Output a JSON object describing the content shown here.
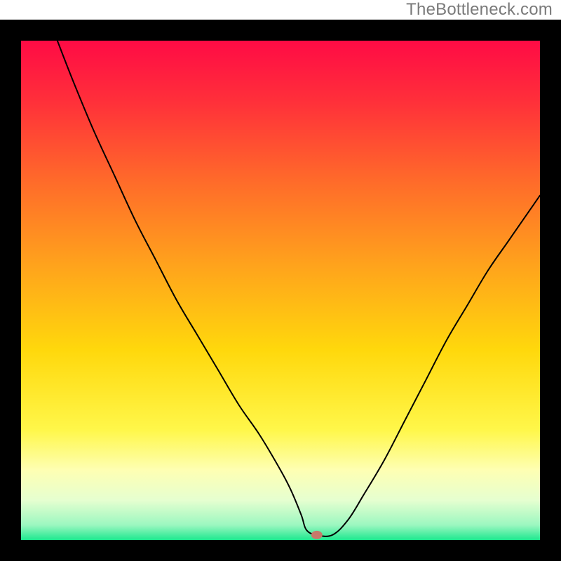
{
  "watermark": "TheBottleneck.com",
  "chart_data": {
    "type": "line",
    "title": "",
    "xlabel": "",
    "ylabel": "",
    "xlim": [
      0,
      100
    ],
    "ylim": [
      0,
      100
    ],
    "grid": false,
    "legend": false,
    "background": {
      "type": "vertical-gradient",
      "stops": [
        {
          "offset": 0.0,
          "color": "#ff0b45"
        },
        {
          "offset": 0.12,
          "color": "#ff2f3a"
        },
        {
          "offset": 0.28,
          "color": "#ff6a2a"
        },
        {
          "offset": 0.45,
          "color": "#ffa31c"
        },
        {
          "offset": 0.62,
          "color": "#ffd80c"
        },
        {
          "offset": 0.78,
          "color": "#fff74a"
        },
        {
          "offset": 0.86,
          "color": "#feffb3"
        },
        {
          "offset": 0.92,
          "color": "#e6ffd0"
        },
        {
          "offset": 0.97,
          "color": "#9cf7c0"
        },
        {
          "offset": 1.0,
          "color": "#1ee88f"
        }
      ]
    },
    "series": [
      {
        "name": "bottleneck-curve",
        "stroke": "#000000",
        "stroke_width": 2,
        "x": [
          7,
          10,
          14,
          18,
          22,
          26,
          30,
          34,
          38,
          42,
          46,
          50,
          52,
          54,
          55,
          57,
          60,
          63,
          66,
          70,
          74,
          78,
          82,
          86,
          90,
          94,
          98,
          100
        ],
        "y": [
          100,
          92,
          82,
          73,
          64,
          56,
          48,
          41,
          34,
          27,
          21,
          14,
          10,
          5,
          2,
          1,
          1,
          4,
          9,
          16,
          24,
          32,
          40,
          47,
          54,
          60,
          66,
          69
        ]
      }
    ],
    "marker": {
      "name": "optimal-point",
      "x": 57,
      "y": 1,
      "rx": 8,
      "ry": 6,
      "fill": "#c77a6a"
    },
    "frame": {
      "border_color": "#000000",
      "border_width": 30
    }
  }
}
